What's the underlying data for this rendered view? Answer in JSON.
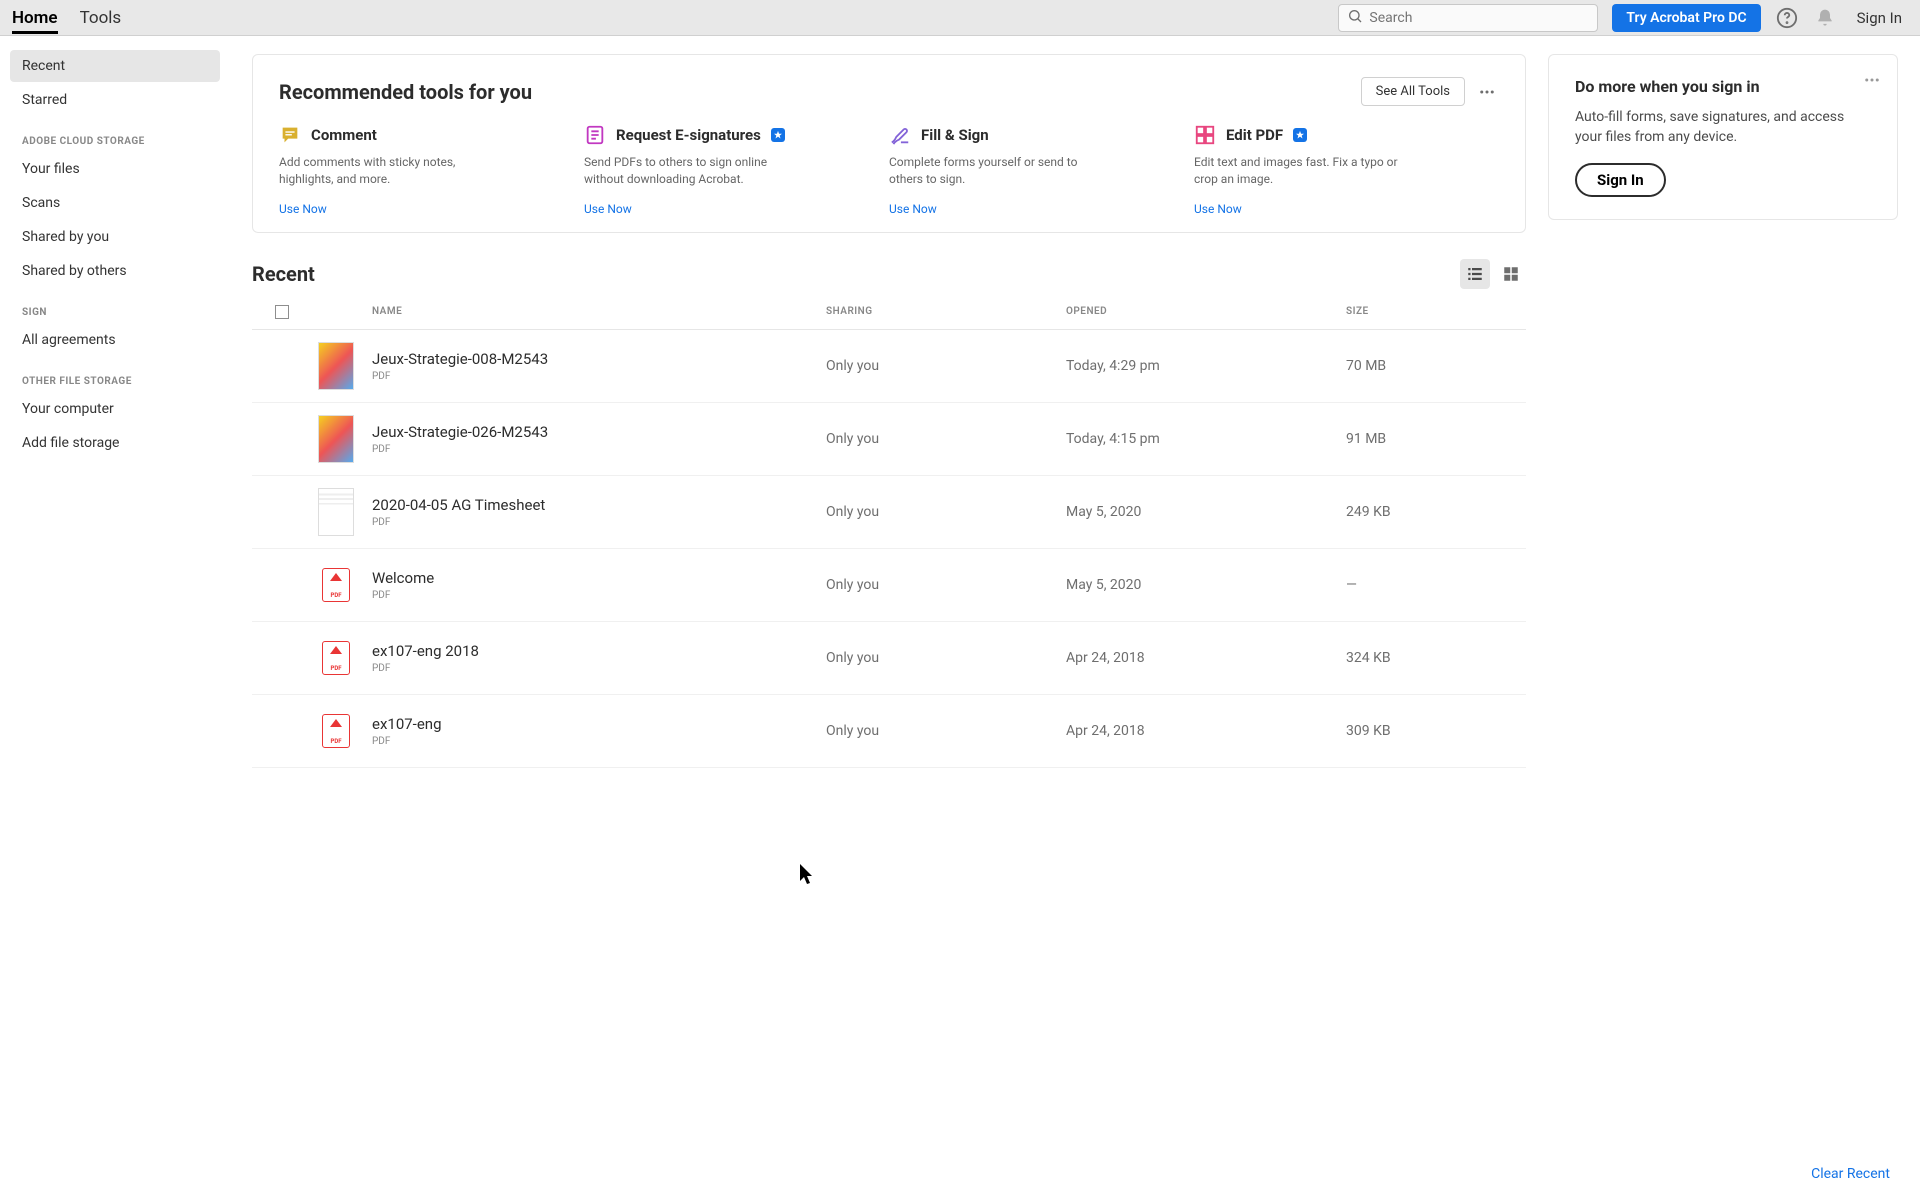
{
  "topbar": {
    "tabs": [
      "Home",
      "Tools"
    ],
    "search_placeholder": "Search",
    "try_button": "Try Acrobat Pro DC",
    "sign_in": "Sign In"
  },
  "sidebar": {
    "items_top": [
      {
        "label": "Recent",
        "selected": true
      },
      {
        "label": "Starred",
        "selected": false
      }
    ],
    "section_cloud": "ADOBE CLOUD STORAGE",
    "items_cloud": [
      {
        "label": "Your files"
      },
      {
        "label": "Scans"
      },
      {
        "label": "Shared by you"
      },
      {
        "label": "Shared by others"
      }
    ],
    "section_sign": "SIGN",
    "items_sign": [
      {
        "label": "All agreements"
      }
    ],
    "section_other": "OTHER FILE STORAGE",
    "items_other": [
      {
        "label": "Your computer"
      },
      {
        "label": "Add file storage"
      }
    ]
  },
  "recommended": {
    "title": "Recommended tools for you",
    "see_all": "See All Tools",
    "tools": [
      {
        "name": "Comment",
        "desc": "Add comments with sticky notes, highlights, and more.",
        "link": "Use Now",
        "color": "#d9b02f",
        "badge": false
      },
      {
        "name": "Request E-signatures",
        "desc": "Send PDFs to others to sign online without downloading Acrobat.",
        "link": "Use Now",
        "color": "#c138c1",
        "badge": true
      },
      {
        "name": "Fill & Sign",
        "desc": "Complete forms yourself or send to others to sign.",
        "link": "Use Now",
        "color": "#8363d8",
        "badge": false
      },
      {
        "name": "Edit PDF",
        "desc": "Edit text and images fast. Fix a typo or crop an image.",
        "link": "Use Now",
        "color": "#e8467f",
        "badge": true
      }
    ]
  },
  "signin_card": {
    "title": "Do more when you sign in",
    "desc": "Auto-fill forms, save signatures, and access your files from any device.",
    "button": "Sign In"
  },
  "files": {
    "title": "Recent",
    "columns": {
      "name": "NAME",
      "sharing": "SHARING",
      "opened": "OPENED",
      "size": "SIZE"
    },
    "rows": [
      {
        "name": "Jeux-Strategie-008-M2543",
        "type": "PDF",
        "sharing": "Only you",
        "opened": "Today, 4:29 pm",
        "size": "70 MB",
        "thumb": "image"
      },
      {
        "name": "Jeux-Strategie-026-M2543",
        "type": "PDF",
        "sharing": "Only you",
        "opened": "Today, 4:15 pm",
        "size": "91 MB",
        "thumb": "image"
      },
      {
        "name": "2020-04-05 AG Timesheet",
        "type": "PDF",
        "sharing": "Only you",
        "opened": "May 5, 2020",
        "size": "249 KB",
        "thumb": "doc"
      },
      {
        "name": "Welcome",
        "type": "PDF",
        "sharing": "Only you",
        "opened": "May 5, 2020",
        "size": "—",
        "thumb": "pdf"
      },
      {
        "name": "ex107-eng 2018",
        "type": "PDF",
        "sharing": "Only you",
        "opened": "Apr 24, 2018",
        "size": "324 KB",
        "thumb": "pdf"
      },
      {
        "name": "ex107-eng",
        "type": "PDF",
        "sharing": "Only you",
        "opened": "Apr 24, 2018",
        "size": "309 KB",
        "thumb": "pdf"
      }
    ],
    "clear": "Clear Recent"
  }
}
